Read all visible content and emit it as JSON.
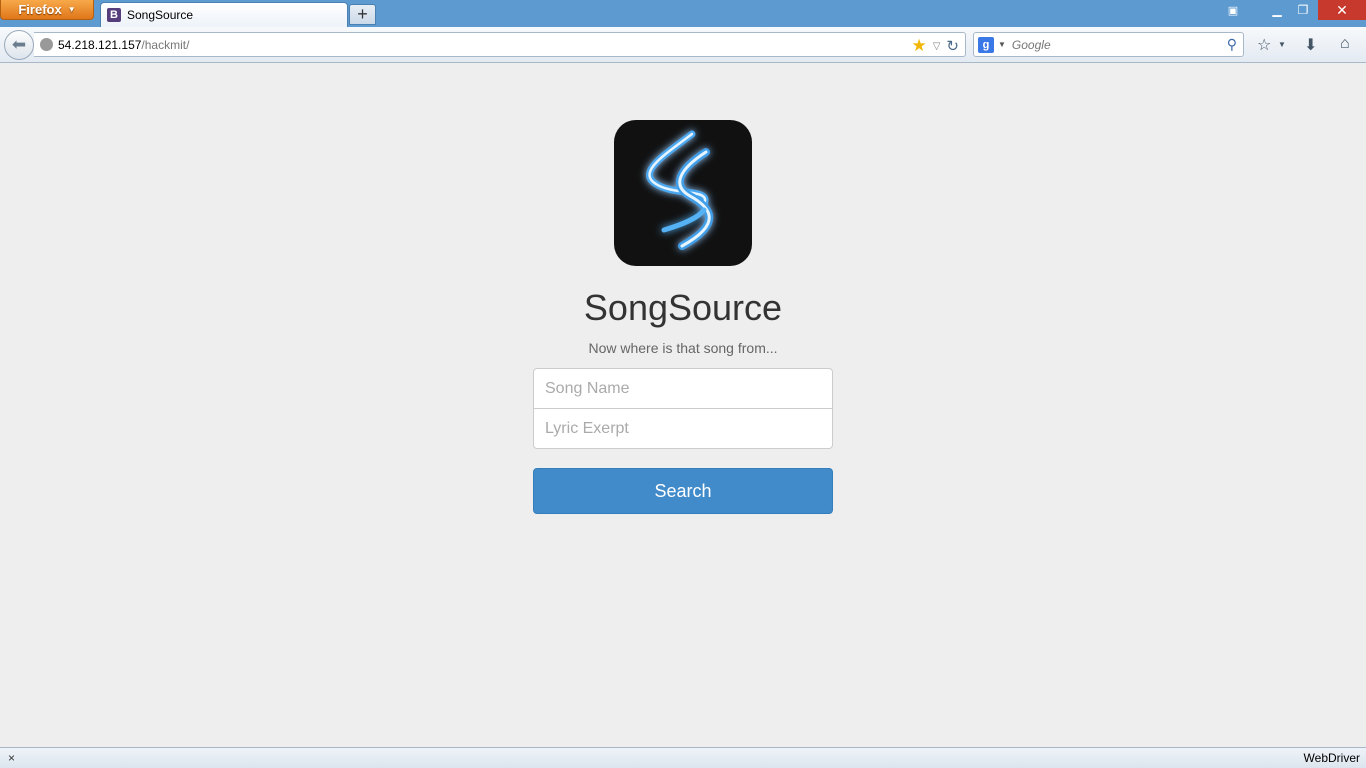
{
  "browser": {
    "menu_label": "Firefox",
    "tab_title": "SongSource",
    "tab_favicon": "B",
    "new_tab": "+",
    "url_host": "54.218.121.157",
    "url_path": "/hackmit/",
    "search_placeholder": "Google",
    "search_engine_letter": "g",
    "status_close": "×",
    "status_right": "WebDriver",
    "icons": {
      "back": "back-arrow-icon",
      "star": "bookmark-star-icon",
      "reload": "reload-icon",
      "search": "magnifier-icon",
      "bookmarks": "bookmarks-icon",
      "download": "download-icon",
      "home": "home-icon"
    }
  },
  "page": {
    "title": "SongSource",
    "tagline": "Now where is that song from...",
    "song_placeholder": "Song Name",
    "lyric_placeholder": "Lyric Exerpt",
    "search_label": "Search",
    "accent": "#428bca"
  }
}
